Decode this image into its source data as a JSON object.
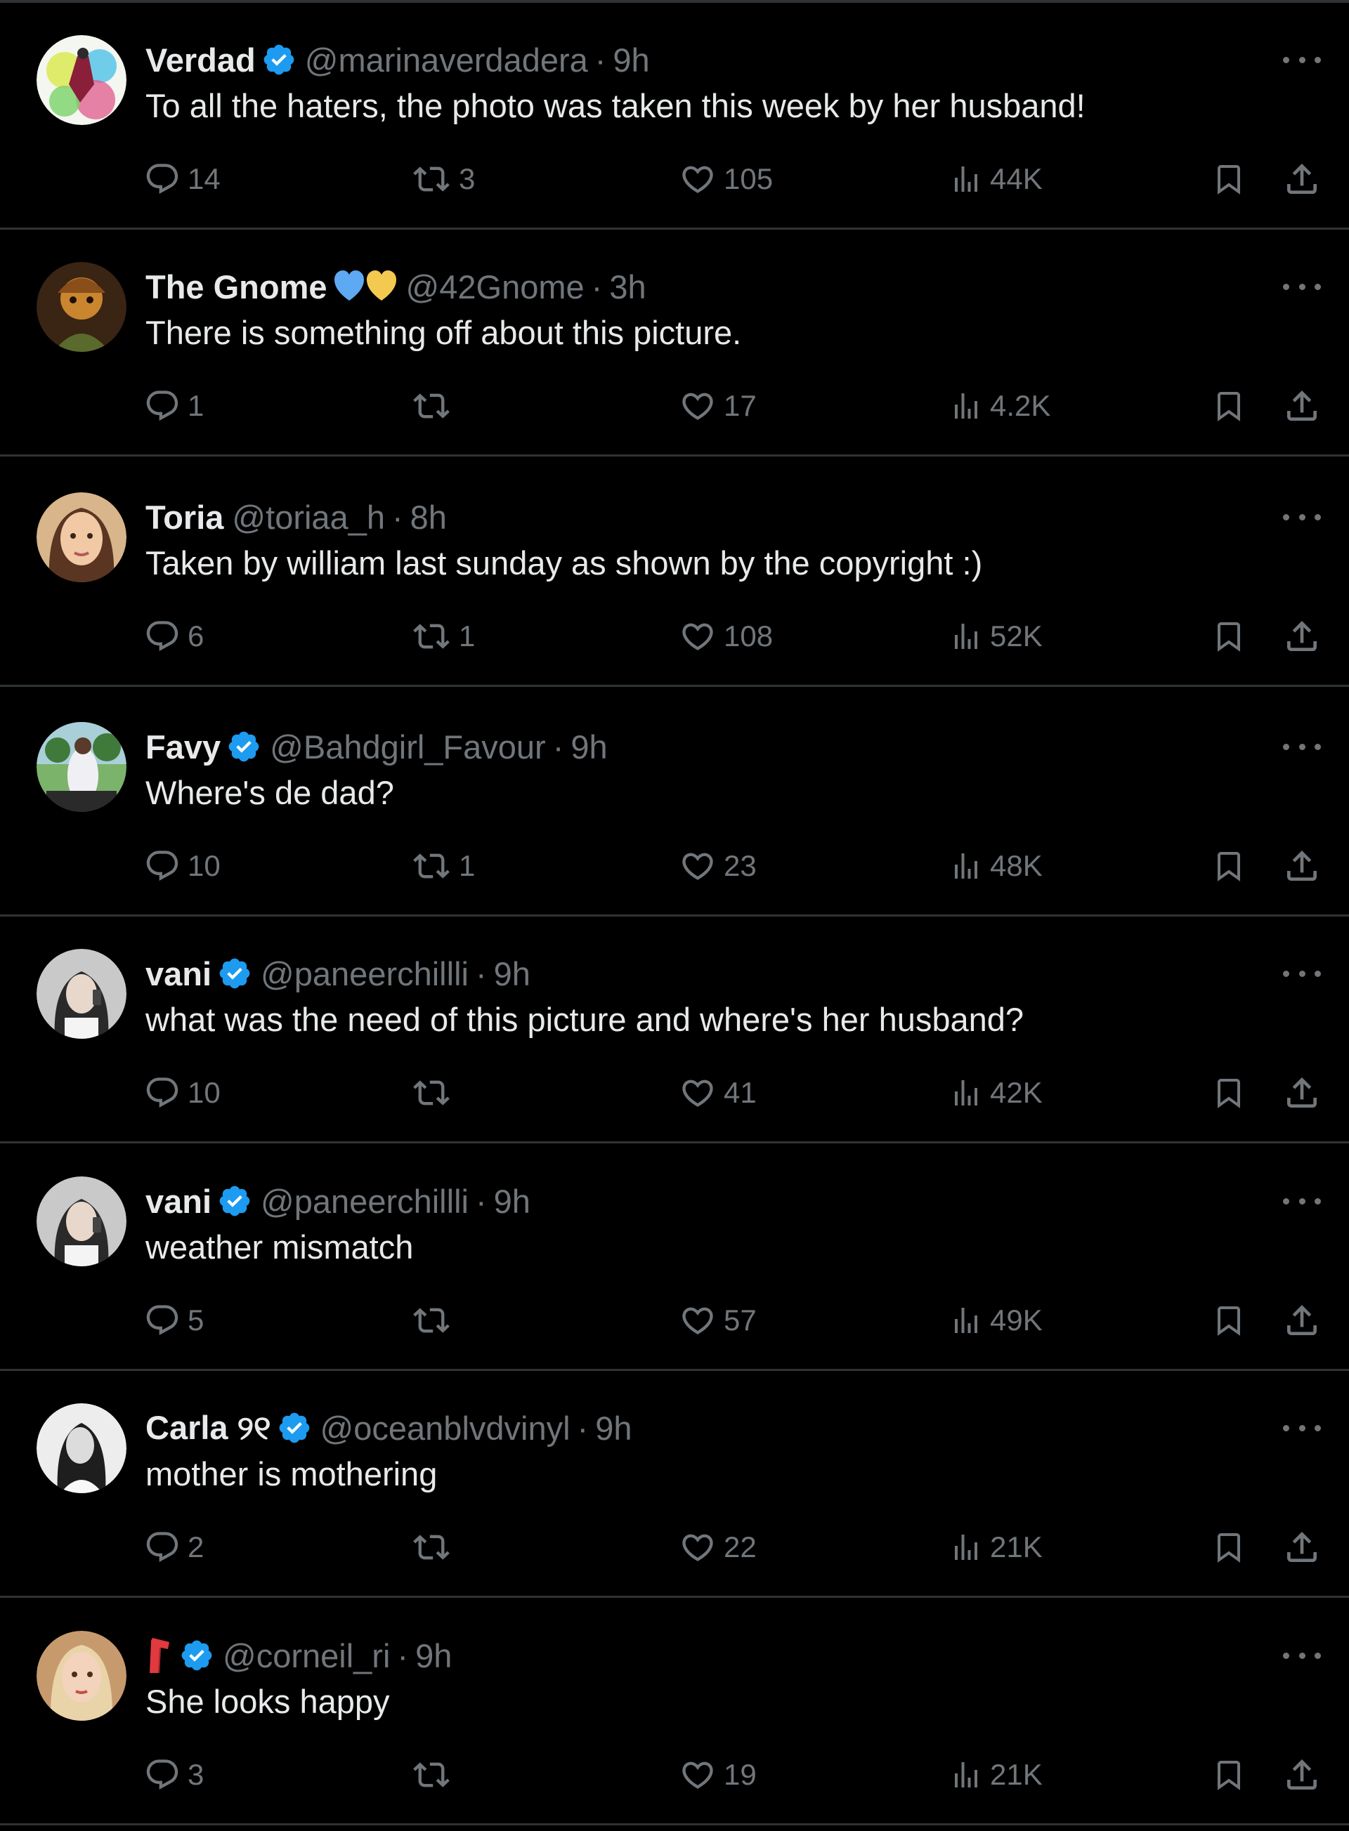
{
  "colors": {
    "background": "#000000",
    "text": "#e7e9ea",
    "muted": "#71767b",
    "verified": "#1d9bf0",
    "divider": "#2f3336"
  },
  "action_icons": [
    "reply-icon",
    "retweet-icon",
    "like-icon",
    "views-icon",
    "bookmark-icon",
    "share-icon"
  ],
  "tweets": [
    {
      "name": "Verdad",
      "verified": true,
      "handle": "@marinaverdadera",
      "sep": "·",
      "time": "9h",
      "text": "To all the haters, the photo was taken this week by her husband!",
      "replies": "14",
      "retweets": "3",
      "likes": "105",
      "views": "44K"
    },
    {
      "name": "The Gnome",
      "verified": false,
      "emoji": "hearts",
      "handle": "@42Gnome",
      "sep": "·",
      "time": "3h",
      "text": "There is something off about this picture.",
      "replies": "1",
      "retweets": "",
      "likes": "17",
      "views": "4.2K"
    },
    {
      "name": "Toria",
      "verified": false,
      "handle": "@toriaa_h",
      "sep": "·",
      "time": "8h",
      "text": "Taken by william last sunday as shown by the copyright :)",
      "replies": "6",
      "retweets": "1",
      "likes": "108",
      "views": "52K"
    },
    {
      "name": "Favy",
      "verified": true,
      "handle": "@Bahdgirl_Favour",
      "sep": "·",
      "time": "9h",
      "text": "Where's de dad?",
      "replies": "10",
      "retweets": "1",
      "likes": "23",
      "views": "48K"
    },
    {
      "name": "vani",
      "verified": true,
      "handle": "@paneerchillli",
      "sep": "·",
      "time": "9h",
      "text": "what was the need of this picture and where's her husband?",
      "replies": "10",
      "retweets": "",
      "likes": "41",
      "views": "42K"
    },
    {
      "name": "vani",
      "verified": true,
      "handle": "@paneerchillli",
      "sep": "·",
      "time": "9h",
      "text": "weather mismatch",
      "replies": "5",
      "retweets": "",
      "likes": "57",
      "views": "49K"
    },
    {
      "name": "Carla ୨୧",
      "verified": true,
      "handle": "@oceanblvdvinyl",
      "sep": "·",
      "time": "9h",
      "text": "mother is mothering",
      "replies": "2",
      "retweets": "",
      "likes": "22",
      "views": "21K"
    },
    {
      "name": "",
      "verified": true,
      "emoji": "red-lipstick",
      "handle": "@corneil_ri",
      "sep": "·",
      "time": "9h",
      "text": "She looks happy",
      "replies": "3",
      "retweets": "",
      "likes": "19",
      "views": "21K"
    }
  ]
}
